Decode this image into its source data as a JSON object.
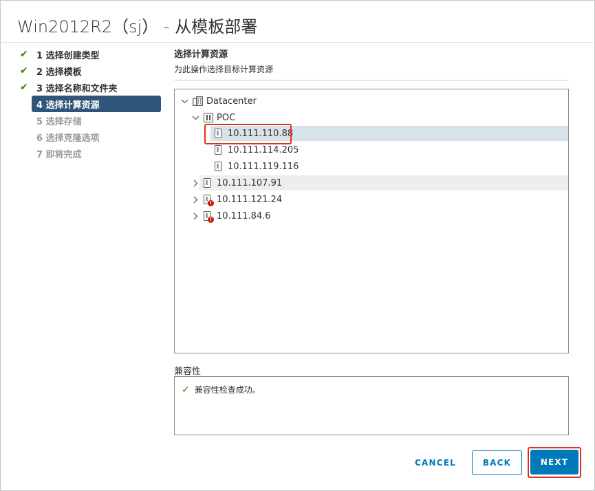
{
  "dialog": {
    "title": "Win2012R2（sj） - 从模板部署"
  },
  "steps": [
    {
      "label": "1 选择创建类型",
      "state": "done"
    },
    {
      "label": "2 选择模板",
      "state": "done"
    },
    {
      "label": "3 选择名称和文件夹",
      "state": "done"
    },
    {
      "label": "4 选择计算资源",
      "state": "current"
    },
    {
      "label": "5 选择存储",
      "state": "pending"
    },
    {
      "label": "6 选择克隆选项",
      "state": "pending"
    },
    {
      "label": "7 即将完成",
      "state": "pending"
    }
  ],
  "section": {
    "title": "选择计算资源",
    "subtitle": "为此操作选择目标计算资源"
  },
  "tree": {
    "datacenter": "Datacenter",
    "cluster": "POC",
    "cluster_hosts": [
      "10.111.110.88",
      "10.111.114.205",
      "10.111.119.116"
    ],
    "other_hosts": [
      "10.111.107.91",
      "10.111.121.24",
      "10.111.84.6"
    ],
    "selected": "10.111.110.88"
  },
  "compatibility": {
    "title": "兼容性",
    "message": "兼容性检查成功。"
  },
  "buttons": {
    "cancel": "CANCEL",
    "back": "BACK",
    "next": "NEXT"
  },
  "colors": {
    "primary": "#0079b8",
    "current_step": "#30557a",
    "success": "#2f8400",
    "alert": "#c21d00",
    "annotation_red": "#e0311f"
  }
}
